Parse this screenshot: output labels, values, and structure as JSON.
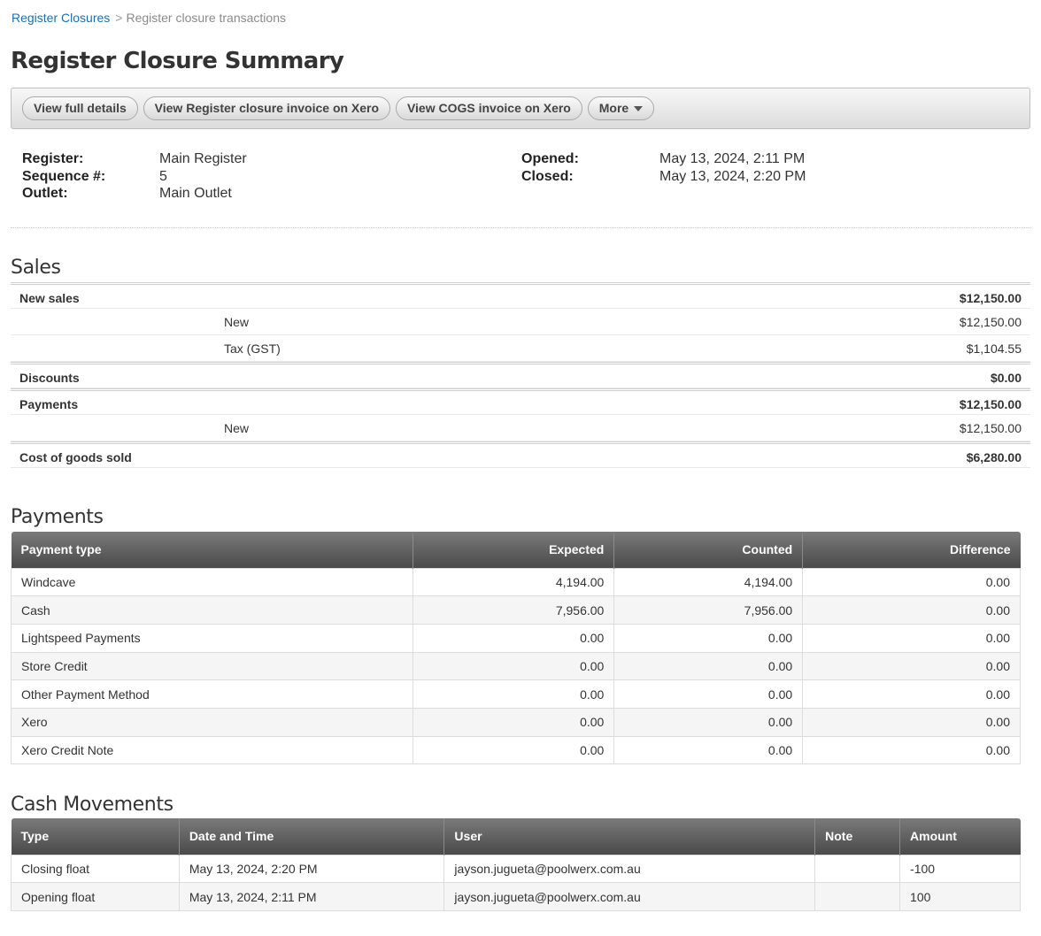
{
  "breadcrumb": {
    "link": "Register Closures",
    "separator": ">",
    "current": "Register closure transactions"
  },
  "title": "Register Closure Summary",
  "toolbar": {
    "view_full_details": "View full details",
    "view_closure_invoice": "View Register closure invoice on Xero",
    "view_cogs_invoice": "View COGS invoice on Xero",
    "more": "More"
  },
  "info": {
    "register_label": "Register:",
    "register": "Main Register",
    "sequence_label": "Sequence #:",
    "sequence": "5",
    "outlet_label": "Outlet:",
    "outlet": "Main Outlet",
    "opened_label": "Opened:",
    "opened": "May 13, 2024, 2:11 PM",
    "closed_label": "Closed:",
    "closed": "May 13, 2024, 2:20 PM"
  },
  "sales": {
    "heading": "Sales",
    "new_sales_label": "New sales",
    "new_sales_total": "$12,150.00",
    "new_label": "New",
    "new_value": "$12,150.00",
    "tax_label": "Tax (GST)",
    "tax_value": "$1,104.55",
    "discounts_label": "Discounts",
    "discounts_value": "$0.00",
    "payments_label": "Payments",
    "payments_total": "$12,150.00",
    "payments_new_label": "New",
    "payments_new_value": "$12,150.00",
    "cogs_label": "Cost of goods sold",
    "cogs_value": "$6,280.00"
  },
  "payments": {
    "heading": "Payments",
    "columns": [
      "Payment type",
      "Expected",
      "Counted",
      "Difference"
    ],
    "rows": [
      [
        "Windcave",
        "4,194.00",
        "4,194.00",
        "0.00"
      ],
      [
        "Cash",
        "7,956.00",
        "7,956.00",
        "0.00"
      ],
      [
        "Lightspeed Payments",
        "0.00",
        "0.00",
        "0.00"
      ],
      [
        "Store Credit",
        "0.00",
        "0.00",
        "0.00"
      ],
      [
        "Other Payment Method",
        "0.00",
        "0.00",
        "0.00"
      ],
      [
        "Xero",
        "0.00",
        "0.00",
        "0.00"
      ],
      [
        "Xero Credit Note",
        "0.00",
        "0.00",
        "0.00"
      ]
    ]
  },
  "cash_movements": {
    "heading": "Cash Movements",
    "columns": [
      "Type",
      "Date and Time",
      "User",
      "Note",
      "Amount"
    ],
    "rows": [
      [
        "Closing float",
        "May 13, 2024, 2:20 PM",
        "jayson.jugueta@poolwerx.com.au",
        "",
        "-100"
      ],
      [
        "Opening float",
        "May 13, 2024, 2:11 PM",
        "jayson.jugueta@poolwerx.com.au",
        "",
        "100"
      ]
    ]
  }
}
